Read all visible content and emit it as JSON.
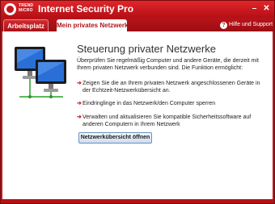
{
  "window": {
    "brand_line1": "TREND",
    "brand_line2": "MICRO",
    "title": "Internet Security Pro",
    "minimize_glyph": "–",
    "close_glyph": "✕"
  },
  "tabs": [
    {
      "label": "Arbeitsplatz",
      "active": false
    },
    {
      "label": "Mein privates Netzwerk",
      "active": true
    }
  ],
  "help": {
    "icon": "help-icon",
    "label": "Hilfe und Support"
  },
  "main": {
    "heading": "Steuerung privater Netzwerke",
    "intro": "Überprüfen Sie regelmäßig Computer und andere Geräte, die derzeit mit Ihrem privaten Netzwerk verbunden sind. Die Funktion ermöglicht:",
    "bullet_glyph": "➔",
    "bullets": [
      "Zeigen Sie die an Ihrem privaten Netzwerk angeschlossenen Geräte in der Echtzeit-Netzwerkübersicht an.",
      "Eindringlinge in das Netzwerk/den Computer sperren",
      "Verwalten und aktualisieren Sie kompatible Sicherheitssoftware auf anderen Computern in Ihrem Netzwerk"
    ],
    "button_label": "Netzwerkübersicht öffnen"
  },
  "colors": {
    "brand_red": "#c4161c",
    "tab_active_text": "#b0161b",
    "bullet_red": "#d11b20",
    "monitor_blue": "#2a6fd6"
  }
}
